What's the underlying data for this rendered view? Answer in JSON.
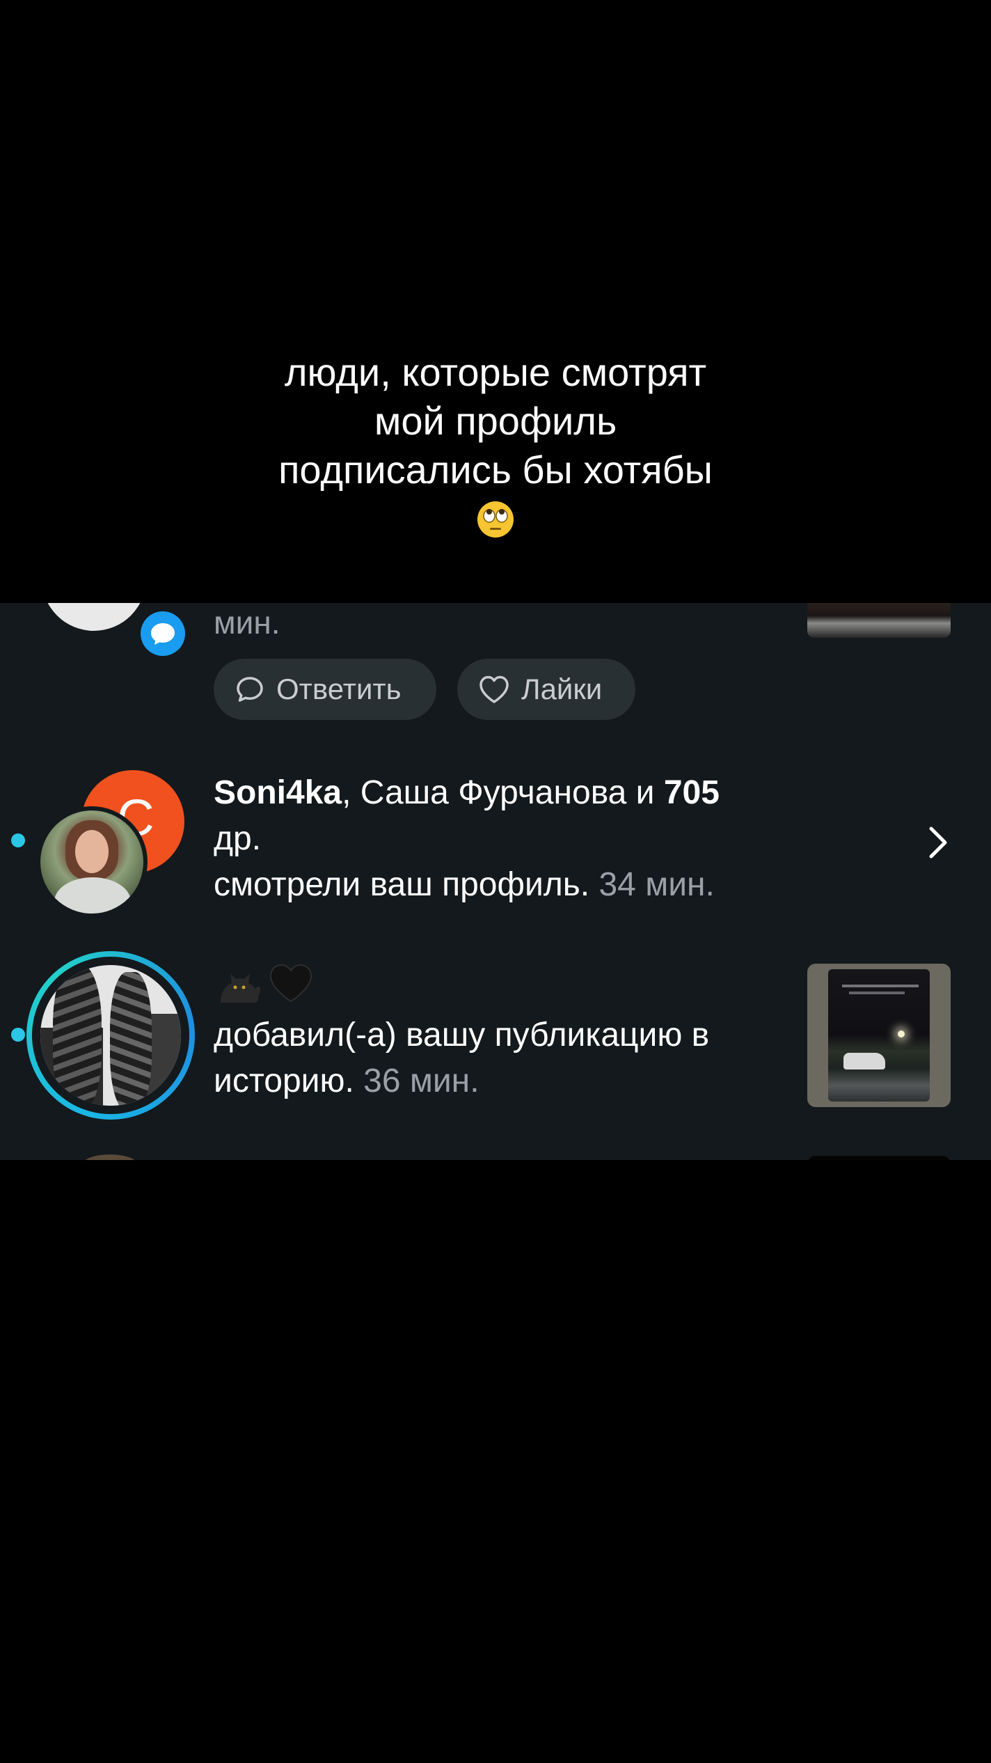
{
  "caption": {
    "line1": "люди, которые смотрят",
    "line2": "мой профиль",
    "line3": "подписались бы хотябы",
    "emoji_icon": "face-with-rolling-eyes-icon"
  },
  "notifications": {
    "partial_row": {
      "time_fragment": "мин.",
      "reply_label": "Ответить",
      "likes_label": "Лайки"
    },
    "profile_views": {
      "user1": "Soni4ka",
      "sep": ", ",
      "user2": "Саша Фурчанова",
      "and": " и ",
      "count": "705",
      "others": "др.",
      "action": "смотрели ваш профиль.",
      "time": "34 мин.",
      "letter_avatar": "С"
    },
    "story_share": {
      "emoji_icons": [
        "cat-icon",
        "black-heart-icon"
      ],
      "action": "добавил(-а) вашу публикацию в историю.",
      "time": "36 мин."
    }
  },
  "colors": {
    "background": "#000000",
    "panel": "#13191c",
    "pill": "#283034",
    "accent_blue": "#1a9cf0",
    "unread_dot": "#2bc6e6",
    "avatar_orange": "#f0511e",
    "muted_text": "#9aa0a6"
  }
}
